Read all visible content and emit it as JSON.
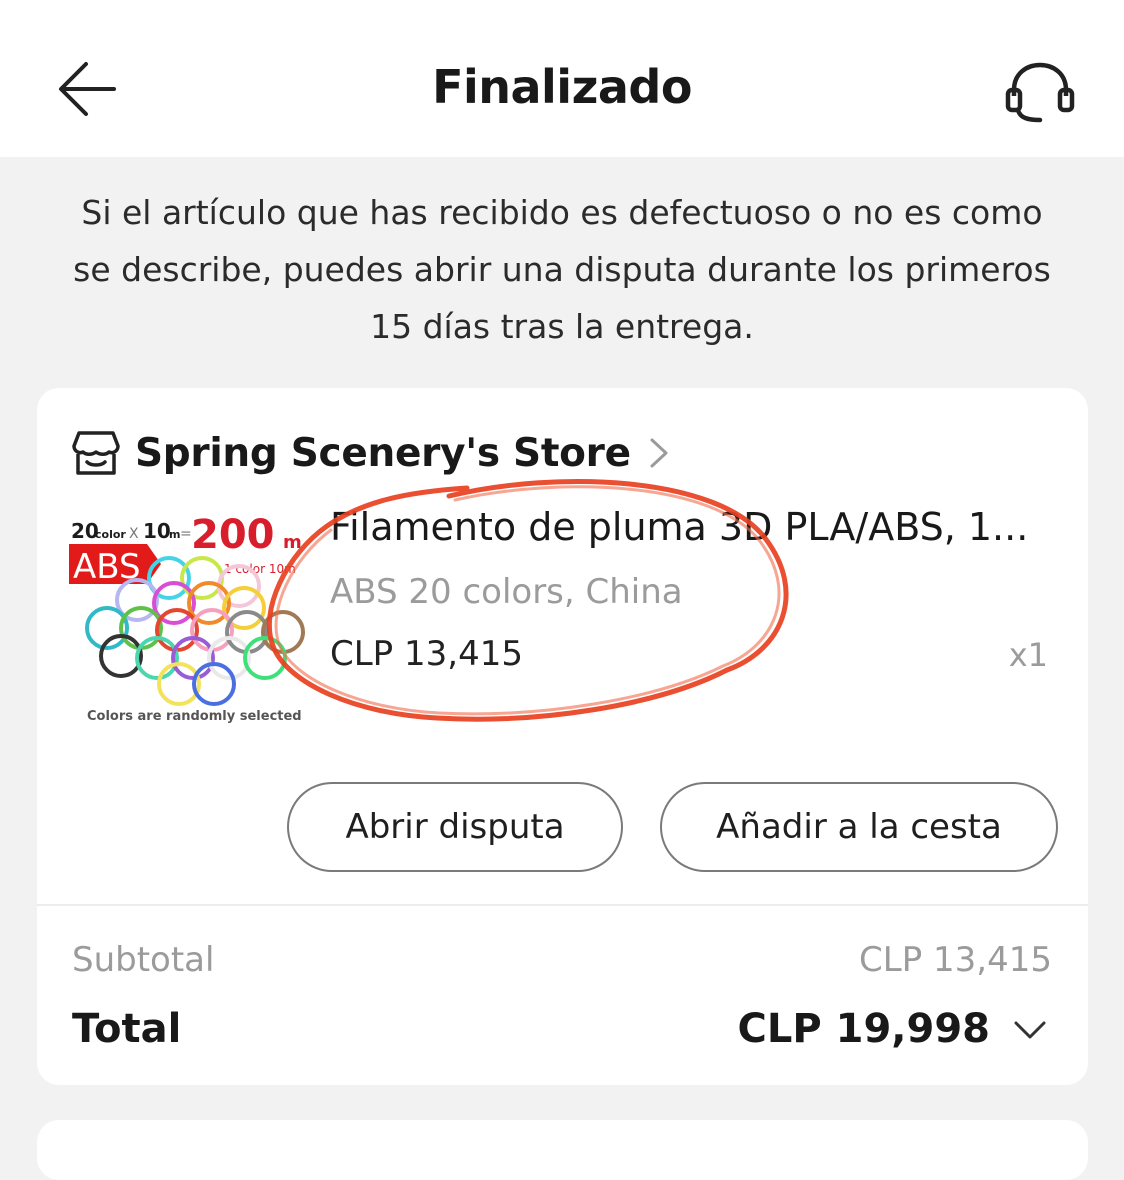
{
  "header": {
    "title": "Finalizado",
    "back_icon": "arrow-left-icon",
    "support_icon": "headset-icon"
  },
  "notice": {
    "text": "Si el artículo que has recibido es defectuoso o no es como se describe, puedes abrir una disputa durante los primeros 15 días tras la entrega."
  },
  "order": {
    "store": {
      "icon": "store-icon",
      "name": "Spring Scenery's Store",
      "chevron_icon": "chevron-right-icon"
    },
    "product": {
      "title": "Filamento de pluma 3D PLA/ABS, 1...",
      "variant": "ABS 20 colors, China",
      "price": "CLP 13,415",
      "quantity": "x1",
      "image_text": {
        "count": "20",
        "color_word": "color",
        "times": "X",
        "length": "10",
        "length_unit": "m",
        "equals": "=",
        "big_number": "200",
        "big_unit": "m",
        "material": "ABS",
        "per_color": "1 color 10m",
        "caption": "Colors are randomly selected"
      }
    },
    "actions": {
      "dispute": "Abrir disputa",
      "add_to_cart": "Añadir a la cesta"
    },
    "summary": {
      "subtotal_label": "Subtotal",
      "subtotal_value": "CLP 13,415",
      "total_label": "Total",
      "total_value": "CLP 19,998",
      "expand_icon": "chevron-down-icon"
    }
  },
  "colors": {
    "background": "#f2f2f2",
    "card": "#ffffff",
    "annotation": "#e8401f",
    "brand_red": "#e21a1a",
    "muted_text": "#9b9b9b"
  }
}
